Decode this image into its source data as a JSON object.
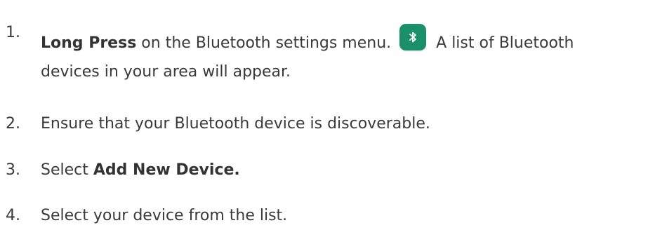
{
  "steps": [
    {
      "number": "1.",
      "bold": "Long Press",
      "before_icon": " on the Bluetooth settings menu.",
      "icon": "bluetooth-icon",
      "after_icon": "A list of Bluetooth",
      "continuation": "devices in your area will appear."
    },
    {
      "number": "2.",
      "text": "Ensure that your Bluetooth device is discoverable."
    },
    {
      "number": "3.",
      "prefix": "Select ",
      "bold": "Add New Device."
    },
    {
      "number": "4.",
      "text": "Select your device from the list."
    }
  ],
  "colors": {
    "text": "#3a3a3a",
    "icon_background": "#1a8f6a",
    "icon_glyph": "#ffffff"
  }
}
